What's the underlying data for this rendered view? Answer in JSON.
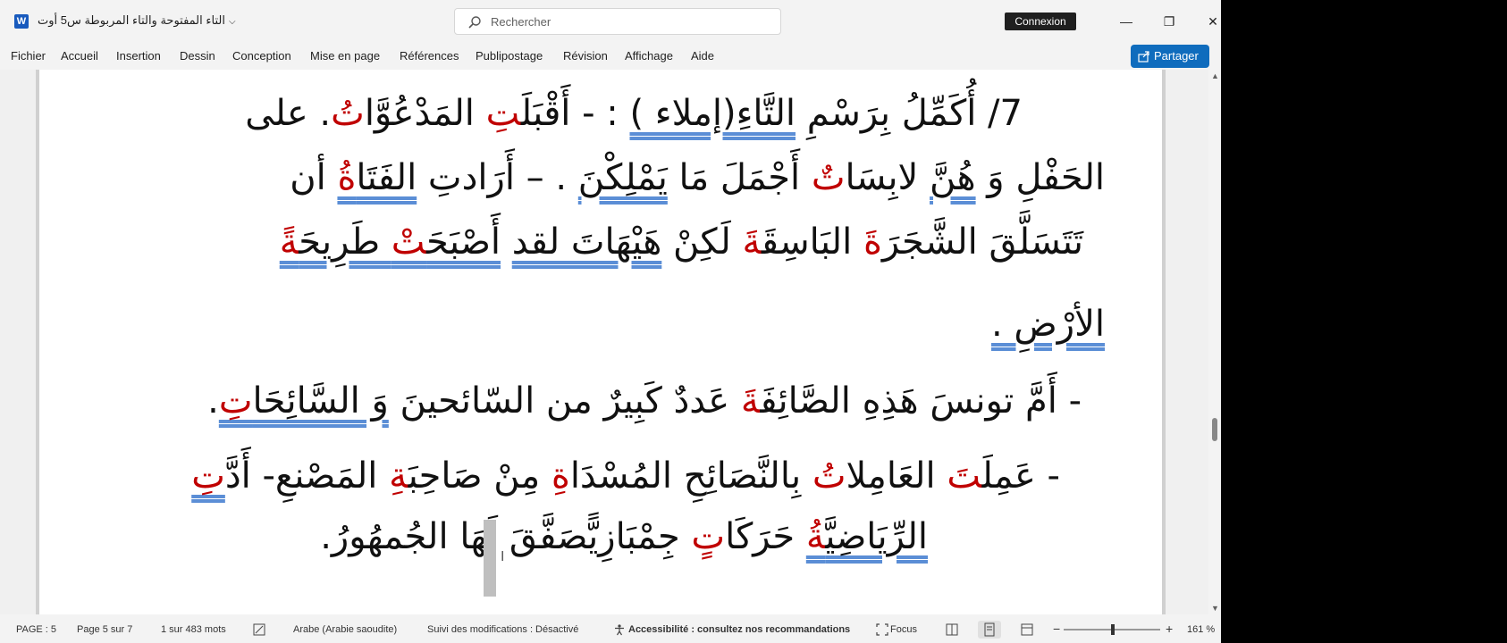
{
  "titlebar": {
    "doc_title": "التاء المفتوحة والتاء المربوطة س5 أوت",
    "search_placeholder": "Rechercher",
    "signin": "Connexion",
    "chevron": "⌵"
  },
  "ribbon": {
    "tabs": [
      "Fichier",
      "Accueil",
      "Insertion",
      "Dessin",
      "Conception",
      "Mise en page",
      "Références",
      "Publipostage",
      "Révision",
      "Affichage",
      "Aide"
    ],
    "share": "Partager"
  },
  "document": {
    "line1": {
      "num": "7/ ",
      "t1": "أُكَمِّلُ بِرَسْمِ ",
      "t2": "التَّاءِ(إملاء )",
      "t3": " : - ",
      "t4": "أَقْبَلَ",
      "t5": "تِ",
      "t6": " المَدْعُوَّا",
      "t7": "تُ",
      "t8": ". على"
    },
    "line2": {
      "t1": "الحَفْلِ وَ ",
      "t2": "هُنَّ",
      "t3": " لابِسَا",
      "t4": "تٌ",
      "t5": "   أَجْمَلَ مَا ",
      "t6": "يَمْلِكْنَ",
      "t7": " .  – أَرَادتِ ",
      "t8": "الفَتَا",
      "t9": "ةُ",
      "t10": " أن"
    },
    "line3": {
      "t1": "تَتَسَلَّقَ الشَّجَرَ",
      "t2": "ةَ",
      "t3": " البَاسِقَ",
      "t4": "ةَ",
      "t5": "  لَكِنْ  ",
      "t6": "هَيْهَاتَ  لقد",
      "t7": "  ",
      "t8": "أَصْبَحَ",
      "t9": "تْ",
      "t10": " طَرِيحَ",
      "t11": "ةً"
    },
    "line4": {
      "t1": "الأرْضِ ."
    },
    "line5": {
      "t1": "- أَمَّ تونسَ هَذِهِ الصَّائِفَ",
      "t2": "ةَ",
      "t3": " عَددٌ كَبِيرٌ من السّائحينَ ",
      "t4": "وَ السَّائِحَا",
      "t5": "تِ",
      "t6": "."
    },
    "line6": {
      "t1": "- عَمِلَ",
      "t2": "تَ",
      "t3": " العَامِلا",
      "t4": "تُ",
      "t5": " بِالنَّصَائِحِ المُسْدَا",
      "t6": "ةِ",
      "t7": " مِنْ صَاحِبَ",
      "t8": "ةِ",
      "t9": " المَصْنعِ- أَدَّ",
      "t10": "تِ"
    },
    "line7": {
      "t1": "الرِّيَاضِيَّ",
      "t2": "ةُ",
      "t3": "  حَرَكَا",
      "t4": "تٍ",
      "t5": " جِمْبَازِيًّ",
      "t6": "صَفَّقَ لَهَا الجُمهُورُ."
    }
  },
  "statusbar": {
    "page": "PAGE : 5",
    "page_of": "Page 5 sur 7",
    "words": "1 sur 483 mots",
    "language": "Arabe (Arabie saoudite)",
    "track": "Suivi des modifications : Désactivé",
    "accessibility": "Accessibilité : consultez nos recommandations",
    "focus": "Focus",
    "zoom_minus": "−",
    "zoom_plus": "+",
    "zoom": "161 %"
  },
  "colors": {
    "accent": "#0f6cbd",
    "red_text": "#c00000",
    "word_blue": "#185abd"
  }
}
